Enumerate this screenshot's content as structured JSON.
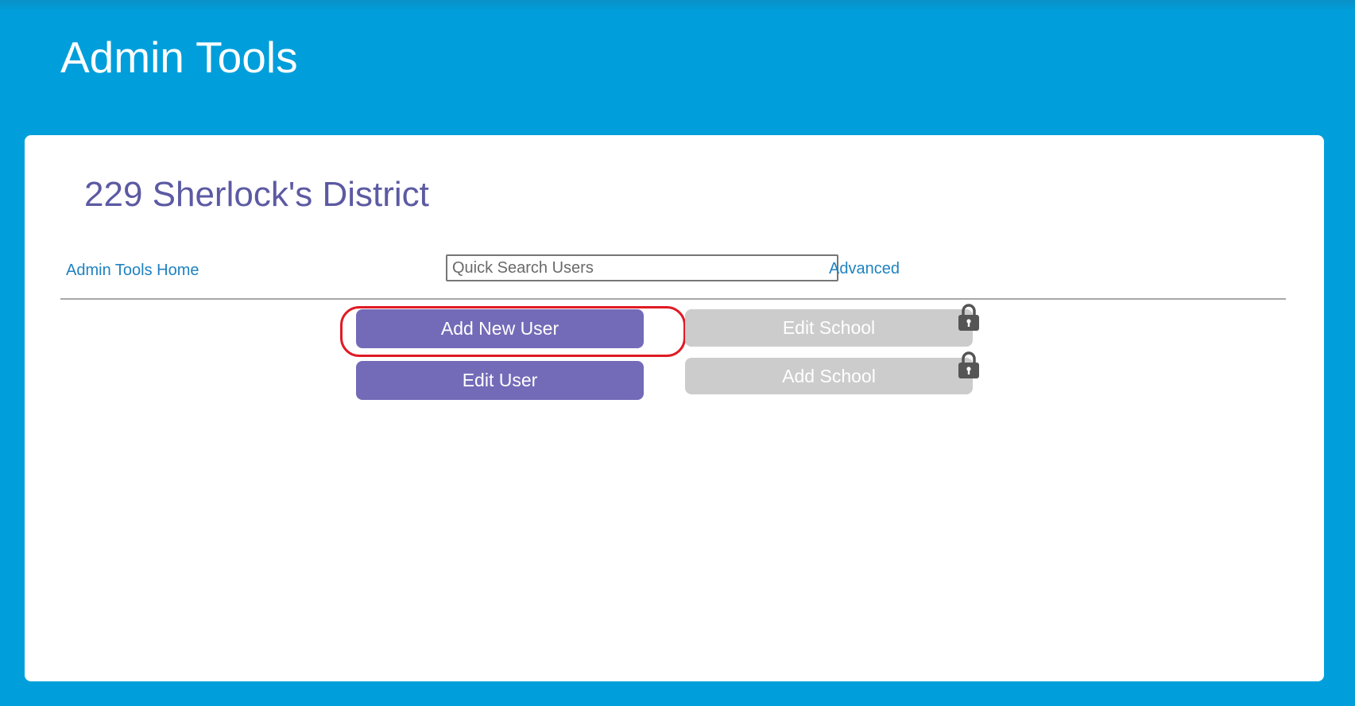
{
  "header": {
    "title": "Admin Tools"
  },
  "panel": {
    "district_name": "229 Sherlock's District",
    "nav": {
      "home_link": "Admin Tools Home",
      "advanced_link": "Advanced"
    },
    "search": {
      "placeholder": "Quick Search Users",
      "value": ""
    },
    "actions": {
      "add_new_user": "Add New User",
      "edit_user": "Edit User",
      "edit_school": "Edit School",
      "add_school": "Add School"
    }
  },
  "icons": {
    "lock": "padlock-icon"
  },
  "colors": {
    "background": "#009fdb",
    "primary_button": "#736bb8",
    "disabled_button": "#cccccc",
    "link": "#1f82c1",
    "district_title": "#5c5aa3",
    "highlight": "#e01b24"
  }
}
